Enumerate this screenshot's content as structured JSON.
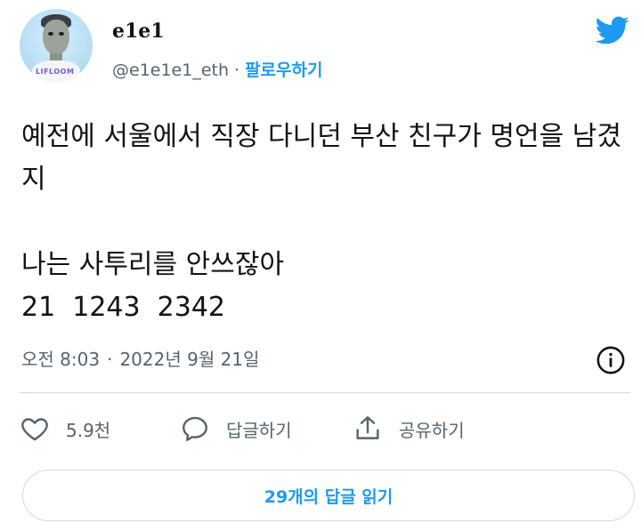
{
  "author": {
    "display_name": "e1e1",
    "handle": "@e1e1e1_eth",
    "separator": "·",
    "follow_label": "팔로우하기",
    "avatar_brand_text": "LIFLOOM"
  },
  "tweet": {
    "text": "예전에 서울에서 직장 다니던 부산 친구가 명언을 남겼지\n\n나는 사투리를 안쓰잖아\n21  1243  2342"
  },
  "meta": {
    "time": "오전 8:03",
    "separator": "·",
    "date": "2022년 9월 21일"
  },
  "actions": {
    "like_count": "5.9천",
    "reply_label": "답글하기",
    "share_label": "공유하기"
  },
  "read_replies_label": "29개의 답글 읽기",
  "colors": {
    "brand_blue": "#1d9bf0",
    "secondary_text": "#536471",
    "primary_text": "#0f1419",
    "border": "#cfd9de"
  },
  "icons": [
    "twitter-bird-icon",
    "info-icon",
    "heart-icon",
    "speech-bubble-icon",
    "share-icon"
  ]
}
